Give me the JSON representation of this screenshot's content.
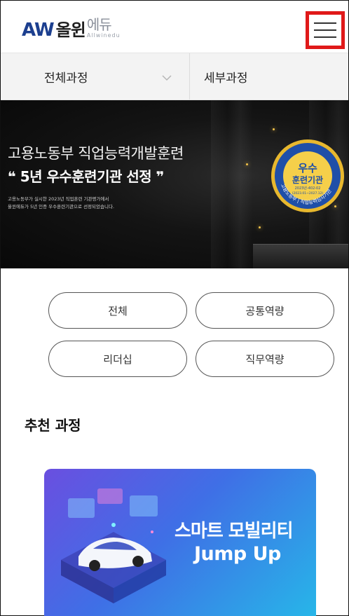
{
  "header": {
    "logo_mark": "AW",
    "logo_korean": "올윈",
    "logo_edu": "에듀",
    "logo_sub": "Allwinedu"
  },
  "categories": {
    "primary": "전체과정",
    "secondary": "세부과정"
  },
  "banner": {
    "line1": "고용노동부 직업능력개발훈련",
    "line2": "❝ 5년 우수훈련기관 선정 ❞",
    "desc1": "고용노동부가 실시한 2023년 직업훈련 기관평가에서",
    "desc2": "올윈에듀가 5년 인증 우수훈련기관으로 선정되었습니다.",
    "badge": {
      "top": "우수",
      "middle": "훈련기관",
      "code": "2023년-402-02",
      "period": "(2023.01~2027.12)",
      "ring": "고용노동부 | 직업능력심사기관"
    }
  },
  "filters": [
    "전체",
    "공통역량",
    "리더십",
    "직무역량"
  ],
  "section": {
    "title": "추천 과정"
  },
  "course": {
    "title_line1": "스마트 모빌리티",
    "title_line2": "Jump Up"
  },
  "colors": {
    "brand_blue": "#1c3f8f",
    "highlight_red": "#e01919",
    "badge_gold": "#e8b82e",
    "badge_blue": "#1f4fa8"
  }
}
